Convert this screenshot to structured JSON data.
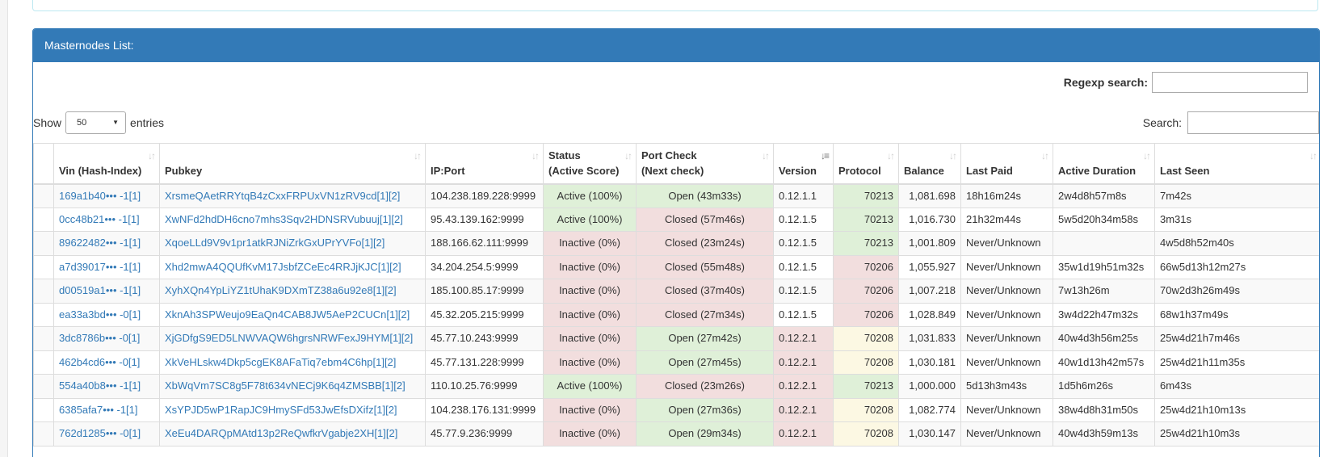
{
  "panel": {
    "title": "Masternodes List:"
  },
  "regexp": {
    "label": "Regexp search:",
    "value": ""
  },
  "length": {
    "prefix": "Show",
    "selected": "50",
    "suffix": "entries"
  },
  "search": {
    "label": "Search:",
    "value": ""
  },
  "columns": [
    {
      "key": "index",
      "line1": "",
      "line2": ""
    },
    {
      "key": "vin",
      "line1": "",
      "line2": "Vin (Hash-Index)"
    },
    {
      "key": "pubkey",
      "line1": "",
      "line2": "Pubkey"
    },
    {
      "key": "ip",
      "line1": "",
      "line2": "IP:Port"
    },
    {
      "key": "status",
      "line1": "Status",
      "line2": "(Active Score)"
    },
    {
      "key": "port",
      "line1": "Port Check",
      "line2": "(Next check)"
    },
    {
      "key": "version",
      "line1": "",
      "line2": "Version",
      "sorted": true
    },
    {
      "key": "protocol",
      "line1": "",
      "line2": "Protocol"
    },
    {
      "key": "balance",
      "line1": "",
      "line2": "Balance"
    },
    {
      "key": "lastpaid",
      "line1": "",
      "line2": "Last Paid"
    },
    {
      "key": "duration",
      "line1": "",
      "line2": "Active Duration"
    },
    {
      "key": "lastseen",
      "line1": "",
      "line2": "Last Seen"
    }
  ],
  "rows": [
    {
      "vin": "169a1b40••• -1[1]",
      "pubkey": "XrsmeQAetRRYtqB4zCxxFRPUxVN1zRV9cd[1][2]",
      "ip": "104.238.189.228:9999",
      "status": "Active (100%)",
      "status_state": "ok",
      "port": "Open (43m33s)",
      "port_state": "ok",
      "version": "0.12.1.1",
      "version_state": "none",
      "protocol": "70213",
      "protocol_state": "ok",
      "balance": "1,081.698",
      "lastpaid": "18h16m24s",
      "duration": "2w4d8h57m8s",
      "lastseen": "7m42s"
    },
    {
      "vin": "0cc48b21••• -1[1]",
      "pubkey": "XwNFd2hdDH6cno7mhs3Sqv2HDNSRVubuuj[1][2]",
      "ip": "95.43.139.162:9999",
      "status": "Active (100%)",
      "status_state": "ok",
      "port": "Closed (57m46s)",
      "port_state": "bad",
      "version": "0.12.1.5",
      "version_state": "none",
      "protocol": "70213",
      "protocol_state": "ok",
      "balance": "1,016.730",
      "lastpaid": "21h32m44s",
      "duration": "5w5d20h34m58s",
      "lastseen": "3m31s"
    },
    {
      "vin": "89622482••• -1[1]",
      "pubkey": "XqoeLLd9V9v1pr1atkRJNiZrkGxUPrYVFo[1][2]",
      "ip": "188.166.62.111:9999",
      "status": "Inactive (0%)",
      "status_state": "bad",
      "port": "Closed (23m24s)",
      "port_state": "bad",
      "version": "0.12.1.5",
      "version_state": "none",
      "protocol": "70213",
      "protocol_state": "ok",
      "balance": "1,001.809",
      "lastpaid": "Never/Unknown",
      "duration": "",
      "lastseen": "4w5d8h52m40s"
    },
    {
      "vin": "a7d39017••• -1[1]",
      "pubkey": "Xhd2mwA4QQUfKvM17JsbfZCeEc4RRJjKJC[1][2]",
      "ip": "34.204.254.5:9999",
      "status": "Inactive (0%)",
      "status_state": "bad",
      "port": "Closed (55m48s)",
      "port_state": "bad",
      "version": "0.12.1.5",
      "version_state": "none",
      "protocol": "70206",
      "protocol_state": "bad",
      "balance": "1,055.927",
      "lastpaid": "Never/Unknown",
      "duration": "35w1d19h51m32s",
      "lastseen": "66w5d13h12m27s"
    },
    {
      "vin": "d00519a1••• -1[1]",
      "pubkey": "XyhXQn4YpLiYZ1tUhaK9DXmTZ38a6u92e8[1][2]",
      "ip": "185.100.85.17:9999",
      "status": "Inactive (0%)",
      "status_state": "bad",
      "port": "Closed (37m40s)",
      "port_state": "bad",
      "version": "0.12.1.5",
      "version_state": "none",
      "protocol": "70206",
      "protocol_state": "bad",
      "balance": "1,007.218",
      "lastpaid": "Never/Unknown",
      "duration": "7w13h26m",
      "lastseen": "70w2d3h26m49s"
    },
    {
      "vin": "ea33a3bd••• -0[1]",
      "pubkey": "XknAh3SPWeujo9EaQn4CAB8JW5AeP2CUCn[1][2]",
      "ip": "45.32.205.215:9999",
      "status": "Inactive (0%)",
      "status_state": "bad",
      "port": "Closed (27m34s)",
      "port_state": "bad",
      "version": "0.12.1.5",
      "version_state": "none",
      "protocol": "70206",
      "protocol_state": "bad",
      "balance": "1,028.849",
      "lastpaid": "Never/Unknown",
      "duration": "3w4d22h47m32s",
      "lastseen": "68w1h37m49s"
    },
    {
      "vin": "3dc8786b••• -0[1]",
      "pubkey": "XjGDfgS9ED5LNWVAQW6hgrsNRWFexJ9HYM[1][2]",
      "ip": "45.77.10.243:9999",
      "status": "Inactive (0%)",
      "status_state": "bad",
      "port": "Open (27m42s)",
      "port_state": "ok",
      "version": "0.12.2.1",
      "version_state": "bad",
      "protocol": "70208",
      "protocol_state": "warn",
      "balance": "1,031.833",
      "lastpaid": "Never/Unknown",
      "duration": "40w4d3h56m25s",
      "lastseen": "25w4d21h7m46s"
    },
    {
      "vin": "462b4cd6••• -0[1]",
      "pubkey": "XkVeHLskw4Dkp5cgEK8AFaTiq7ebm4C6hp[1][2]",
      "ip": "45.77.131.228:9999",
      "status": "Inactive (0%)",
      "status_state": "bad",
      "port": "Open (27m45s)",
      "port_state": "ok",
      "version": "0.12.2.1",
      "version_state": "bad",
      "protocol": "70208",
      "protocol_state": "warn",
      "balance": "1,030.181",
      "lastpaid": "Never/Unknown",
      "duration": "40w1d13h42m57s",
      "lastseen": "25w4d21h11m35s"
    },
    {
      "vin": "554a40b8••• -1[1]",
      "pubkey": "XbWqVm7SC8g5F78t634vNECj9K6q4ZMSBB[1][2]",
      "ip": "110.10.25.76:9999",
      "status": "Active (100%)",
      "status_state": "ok",
      "port": "Closed (23m26s)",
      "port_state": "bad",
      "version": "0.12.2.1",
      "version_state": "bad",
      "protocol": "70213",
      "protocol_state": "ok",
      "balance": "1,000.000",
      "lastpaid": "5d13h3m43s",
      "duration": "1d5h6m26s",
      "lastseen": "6m43s"
    },
    {
      "vin": "6385afa7••• -1[1]",
      "pubkey": "XsYPJD5wP1RapJC9HmySFd53JwEfsDXifz[1][2]",
      "ip": "104.238.176.131:9999",
      "status": "Inactive (0%)",
      "status_state": "bad",
      "port": "Open (27m36s)",
      "port_state": "ok",
      "version": "0.12.2.1",
      "version_state": "bad",
      "protocol": "70208",
      "protocol_state": "warn",
      "balance": "1,082.774",
      "lastpaid": "Never/Unknown",
      "duration": "38w4d8h31m50s",
      "lastseen": "25w4d21h10m13s"
    },
    {
      "vin": "762d1285••• -0[1]",
      "pubkey": "XeEu4DARQpMAtd13p2ReQwfkrVgabje2XH[1][2]",
      "ip": "45.77.9.236:9999",
      "status": "Inactive (0%)",
      "status_state": "bad",
      "port": "Open (29m34s)",
      "port_state": "ok",
      "version": "0.12.2.1",
      "version_state": "bad",
      "protocol": "70208",
      "protocol_state": "warn",
      "balance": "1,030.147",
      "lastpaid": "Never/Unknown",
      "duration": "40w4d3h59m13s",
      "lastseen": "25w4d21h10m3s"
    }
  ],
  "icons": {
    "sort": "sort-both-icon",
    "sort_active": "sort-numeric-desc-icon",
    "caret": "caret-down-icon"
  },
  "colors": {
    "primary": "#337ab7",
    "success": "#dff0d8",
    "danger": "#f2dede",
    "warning": "#fcf8e3",
    "link": "#337ab7"
  }
}
